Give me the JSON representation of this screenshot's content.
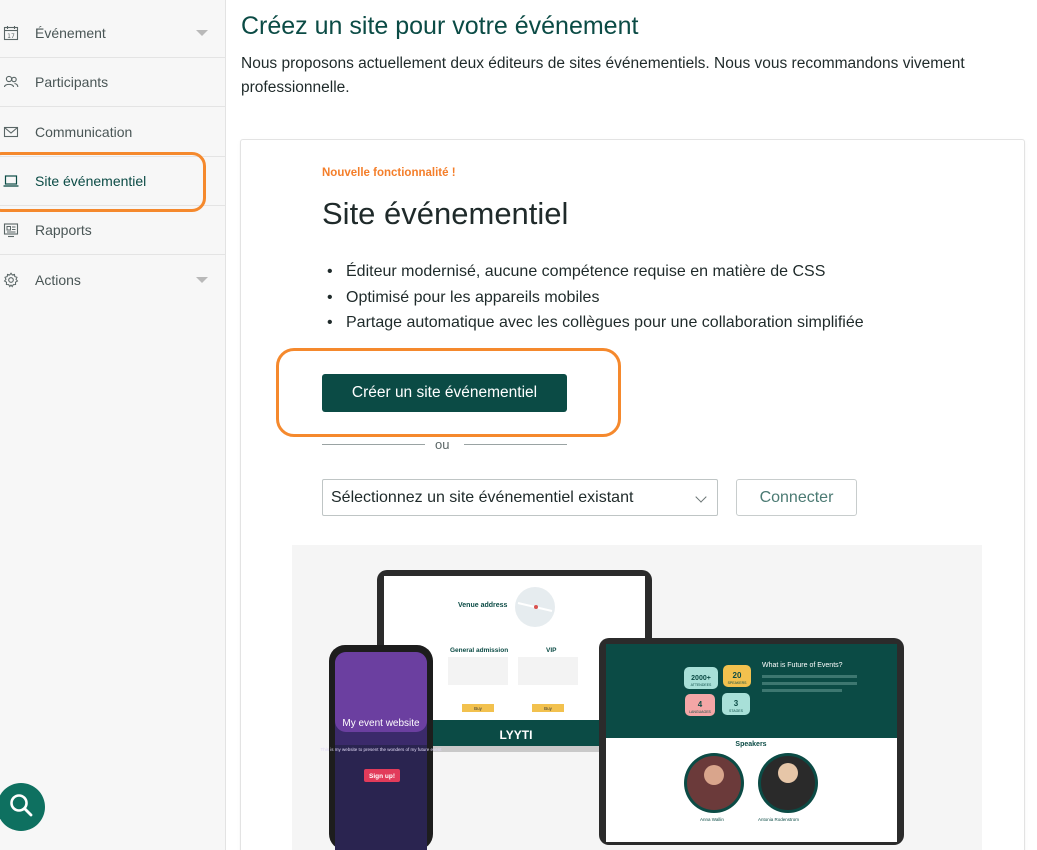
{
  "sidebar": {
    "items": [
      {
        "label": "Événement",
        "icon": "calendar-icon",
        "has_chevron": true
      },
      {
        "label": "Participants",
        "icon": "people-icon",
        "has_chevron": false
      },
      {
        "label": "Communication",
        "icon": "envelope-icon",
        "has_chevron": false
      },
      {
        "label": "Site événementiel",
        "icon": "laptop-icon",
        "has_chevron": false,
        "active": true
      },
      {
        "label": "Rapports",
        "icon": "report-icon",
        "has_chevron": false
      },
      {
        "label": "Actions",
        "icon": "gear-icon",
        "has_chevron": true
      }
    ]
  },
  "header": {
    "title": "Créez un site pour votre événement",
    "description": "Nous proposons actuellement deux éditeurs de sites événementiels. Nous vous recommandons vivement",
    "description_line2": "professionnelle."
  },
  "card": {
    "tag": "Nouvelle fonctionnalité !",
    "title": "Site événementiel",
    "features": [
      "Éditeur modernisé, aucune compétence requise en matière de CSS",
      "Optimisé pour les appareils mobiles",
      "Partage automatique avec les collègues pour une collaboration simplifiée"
    ],
    "create_button": "Créer un site événementiel",
    "or_text": "ou",
    "select_value": "Sélectionnez un site événementiel existant",
    "connect_button": "Connecter"
  },
  "illustration": {
    "venue_title": "Venue address",
    "general_admission": "General admission",
    "vip": "VIP",
    "buy": "Buy",
    "brand": "LYYTI",
    "phone_title": "My event website",
    "phone_subtitle": "This is my website to present the wonders of my future event",
    "phone_cta": "Sign up!",
    "future_title": "What is Future of Events?",
    "stat1": "2000+",
    "stat1_label": "ATTENDEES",
    "stat2": "20",
    "stat2_label": "SPEAKERS",
    "stat3": "4",
    "stat3_label": "LANGUAGES",
    "stat4": "3",
    "stat4_label": "STAGES",
    "speakers_title": "Speakers",
    "speaker1": "Anna Wallin",
    "speaker2": "Antonia Rodenstrom"
  },
  "colors": {
    "brand_dark": "#0b4b45",
    "accent_orange": "#f5892d",
    "tag_orange": "#f47e2a",
    "fab_teal": "#0e7060"
  }
}
